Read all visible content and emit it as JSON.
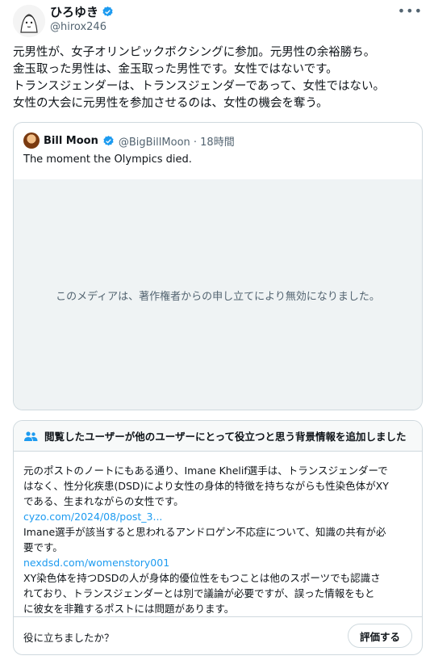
{
  "post": {
    "author": {
      "display_name": "ひろゆき",
      "handle": "@hirox246",
      "verified": true
    },
    "more_icon": "more-icon",
    "text_lines": [
      "元男性が、女子オリンピックボクシングに参加。元男性の余裕勝ち。",
      "金玉取った男性は、金玉取った男性です。女性ではないです。",
      "トランスジェンダーは、トランスジェンダーであって、女性ではない。",
      "女性の大会に元男性を参加させるのは、女性の機会を奪う。"
    ]
  },
  "quote": {
    "display_name": "Bill Moon",
    "verified": true,
    "handle_time": "@BigBillMoon · 18時間",
    "text": "The moment the Olympics died.",
    "media_notice": "このメディアは、著作権者からの申し立てにより無効になりました。"
  },
  "community_note": {
    "header": "閲覧したユーザーが他のユーザーにとって役立つと思う背景情報を追加しました",
    "body_1_lines": [
      "元のポストのノートにもある通り、Imane Khelif選手は、トランスジェンダーで",
      "はなく、性分化疾患(DSD)により女性の身体的特徴を持ちながらも性染色体がXY",
      "である、生まれながらの女性です。"
    ],
    "link_1": "cyzo.com/2024/08/post_3...",
    "body_2_lines": [
      "Imane選手が該当すると思われるアンドロゲン不応症について、知識の共有が必",
      "要です。"
    ],
    "link_2": "nexdsd.com/womenstory001",
    "body_3_lines": [
      "XY染色体を持つDSDの人が身体的優位性をもつことは他のスポーツでも認識さ",
      "れており、トランスジェンダーとは別で議論が必要ですが、誤った情報をもと",
      "に彼女を非難するポストには問題があります。"
    ],
    "helpful_question": "役に立ちましたか？",
    "rate_button": "評価する"
  },
  "colors": {
    "accent": "#1d9bf0",
    "text": "#0f1419",
    "secondary": "#536471",
    "border": "#cfd9de"
  }
}
